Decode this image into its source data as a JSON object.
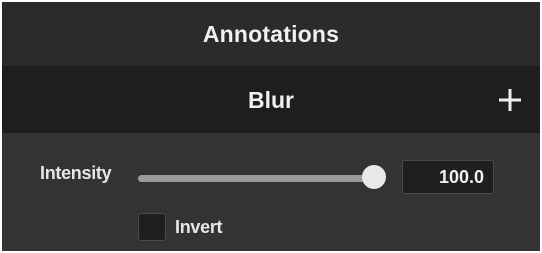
{
  "panel": {
    "title": "Annotations"
  },
  "effect": {
    "name": "Blur",
    "add_icon": "plus-icon"
  },
  "properties": {
    "intensity": {
      "label": "Intensity",
      "value": "100.0",
      "fraction": 1.0
    },
    "invert": {
      "label": "Invert",
      "checked": false
    }
  },
  "colors": {
    "panel_bg": "#2b2b2b",
    "effect_bar_bg": "#1e1e1e",
    "properties_bg": "#333333",
    "text": "#f0f0f0",
    "slider_track": "#8a8a8a",
    "slider_thumb": "#e8e8e8"
  }
}
